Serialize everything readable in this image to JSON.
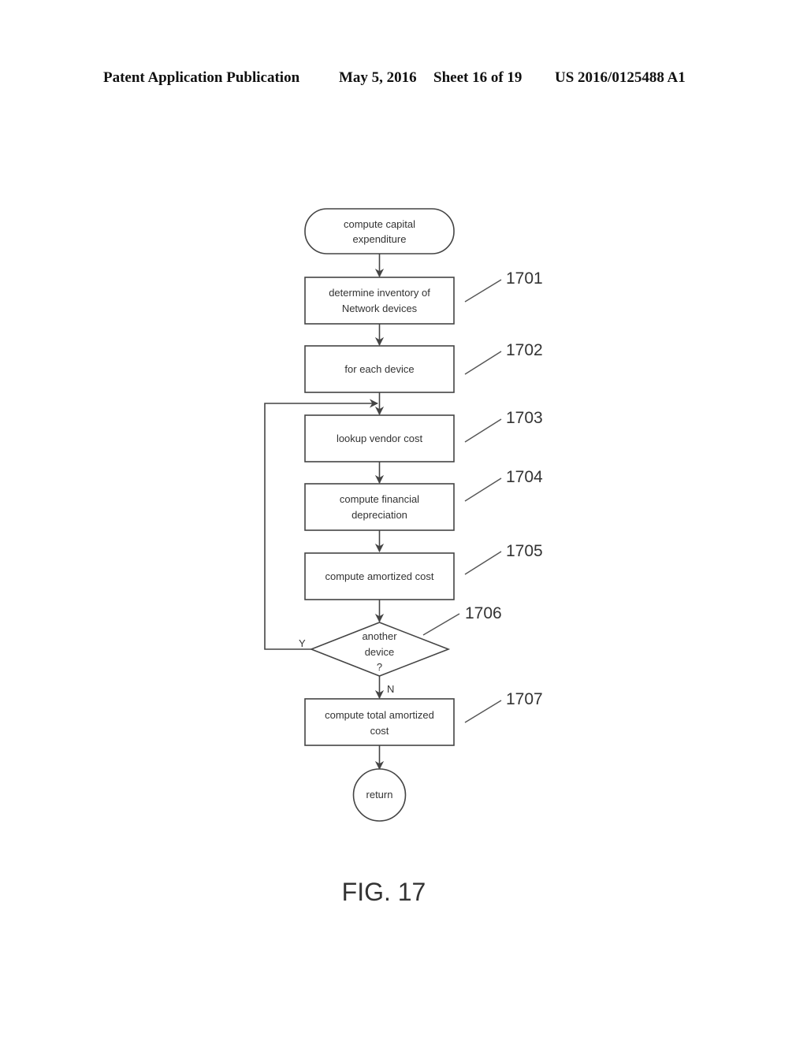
{
  "header": {
    "publication_label": "Patent Application Publication",
    "date": "May 5, 2016",
    "sheet": "Sheet 16 of 19",
    "publication_number": "US 2016/0125488 A1"
  },
  "flowchart": {
    "start": {
      "lines": [
        "compute capital",
        "expenditure"
      ]
    },
    "steps": [
      {
        "ref": "1701",
        "lines": [
          "determine inventory of",
          "Network devices"
        ]
      },
      {
        "ref": "1702",
        "lines": [
          "for each device"
        ]
      },
      {
        "ref": "1703",
        "lines": [
          "lookup vendor cost"
        ]
      },
      {
        "ref": "1704",
        "lines": [
          "compute financial",
          "depreciation"
        ]
      },
      {
        "ref": "1705",
        "lines": [
          "compute amortized cost"
        ]
      }
    ],
    "decision": {
      "ref": "1706",
      "lines": [
        "another",
        "device",
        "?"
      ],
      "yes_label": "Y",
      "no_label": "N"
    },
    "final_step": {
      "ref": "1707",
      "lines": [
        "compute total amortized",
        "cost"
      ]
    },
    "end": {
      "label": "return"
    }
  },
  "figure_label": "FIG. 17"
}
